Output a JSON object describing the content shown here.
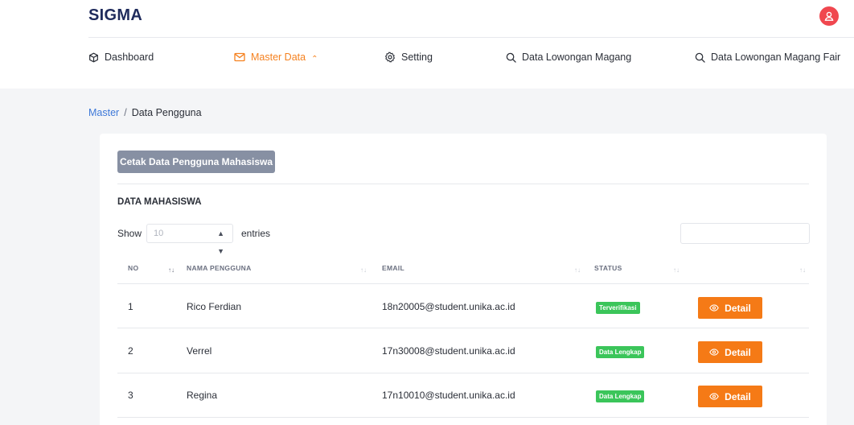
{
  "brand": "SIGMA",
  "nav": {
    "items": [
      {
        "label": "Dashboard"
      },
      {
        "label": "Master Data",
        "chevron": "⌃"
      },
      {
        "label": "Setting"
      },
      {
        "label": "Data Lowongan Magang"
      },
      {
        "label": "Data Lowongan Magang Fair"
      }
    ]
  },
  "breadcrumb": {
    "parent": "Master",
    "separator": "/",
    "current": "Data Pengguna"
  },
  "card": {
    "print_button": "Cetak Data Pengguna Mahasiswa",
    "section_title": "DATA MAHASISWA",
    "show_label": "Show",
    "entries_value": "10",
    "entries_label": "entries",
    "search_value": ""
  },
  "table": {
    "headers": [
      "NO",
      "NAMA PENGGUNA",
      "EMAIL",
      "STATUS",
      ""
    ],
    "rows": [
      {
        "no": "1",
        "name": "Rico Ferdian",
        "email": "18n20005@student.unika.ac.id",
        "status": "Terverifikasi",
        "action": "Detail"
      },
      {
        "no": "2",
        "name": "Verrel",
        "email": "17n30008@student.unika.ac.id",
        "status": "Data Lengkap",
        "action": "Detail"
      },
      {
        "no": "3",
        "name": "Regina",
        "email": "17n10010@student.unika.ac.id",
        "status": "Data Lengkap",
        "action": "Detail"
      }
    ]
  },
  "colors": {
    "accent": "#f5811f",
    "brand": "#1f2b5c",
    "status": "#3bc55a",
    "print_button": "#8790a3"
  }
}
